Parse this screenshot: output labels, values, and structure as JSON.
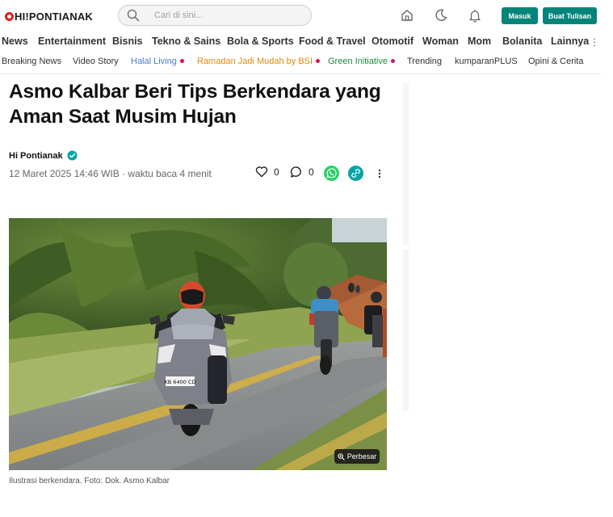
{
  "header": {
    "logo": "HI!PONTIANAK",
    "search_placeholder": "Cari di sini...",
    "login_label": "Masuk",
    "write_label": "Buat Tulisan"
  },
  "nav": {
    "items": [
      "News",
      "Entertainment",
      "Bisnis",
      "Tekno & Sains",
      "Bola & Sports",
      "Food & Travel",
      "Otomotif",
      "Woman",
      "Mom",
      "Bolanita",
      "Lainnya"
    ]
  },
  "subnav": {
    "items": [
      {
        "label": "Breaking News",
        "color": "#333333",
        "dot": false
      },
      {
        "label": "Video Story",
        "color": "#333333",
        "dot": false
      },
      {
        "label": "Halal Living",
        "color": "#4a7cc9",
        "dot": true
      },
      {
        "label": "Ramadan Jadi Mudah by BSI",
        "color": "#e28a0b",
        "dot": true
      },
      {
        "label": "Green Initiative",
        "color": "#1d8a3f",
        "dot": true
      },
      {
        "label": "Trending",
        "color": "#333333",
        "dot": false
      },
      {
        "label": "kumparanPLUS",
        "color": "#333333",
        "dot": false
      },
      {
        "label": "Opini & Cerita",
        "color": "#333333",
        "dot": false
      }
    ]
  },
  "article": {
    "title": "Asmo Kalbar Beri Tips Berkendara yang Aman Saat Musim Hujan",
    "author": "Hi Pontianak",
    "meta": "12 Maret 2025 14:46 WIB · waktu baca 4 menit",
    "likes": "0",
    "comments": "0",
    "enlarge_label": "Perbesar",
    "caption": "Ilustrasi berkendara. Foto: Dok. Asmo Kalbar",
    "plate_text": "KB 6400 CD"
  },
  "colors": {
    "brand": "#00857a",
    "logo_red": "#e21d1d",
    "whatsapp": "#25d366",
    "share": "#00a5a5"
  }
}
